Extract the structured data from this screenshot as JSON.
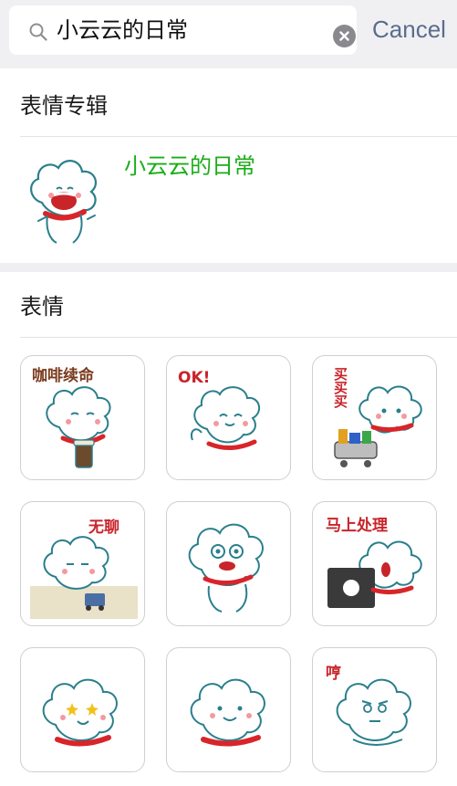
{
  "search": {
    "query": "小云云的日常",
    "cancel_label": "Cancel"
  },
  "album_section": {
    "title": "表情专辑",
    "album_name": "小云云的日常"
  },
  "sticker_section": {
    "title": "表情"
  },
  "stickers": {
    "s1": "咖啡续命",
    "s2": "OK!",
    "s3": "买买买",
    "s4": "无聊",
    "s6": "马上处理",
    "s9": "哼"
  },
  "colors": {
    "accent_green": "#1aad19",
    "cancel_blue": "#5a6d8c",
    "outline_teal": "#2a7f8c",
    "scarf_red": "#d8252a"
  }
}
